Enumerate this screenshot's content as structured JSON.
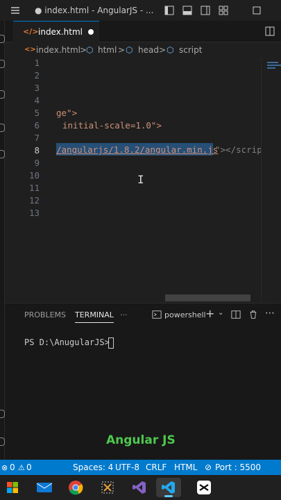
{
  "titlebar": {
    "title": "● index.html - AngularJS - ..."
  },
  "tab": {
    "label": "index.html",
    "icon": "code-icon"
  },
  "breadcrumbs": {
    "file": "index.html",
    "b1": "html",
    "b2": "head",
    "b3": "script",
    "sep": ">"
  },
  "editor": {
    "lines": [
      "1",
      "2",
      "3",
      "4",
      "5",
      "6",
      "7",
      "8",
      "9",
      "10",
      "11",
      "12",
      "13"
    ],
    "line5_text": "ge\">",
    "line6_text": "initial-scale=1.0\">",
    "line8_selected": "/angularjs/1.8.2/angular.min.js",
    "line8_rest": "\"></script"
  },
  "panel": {
    "tabs": [
      "PROBLEMS",
      "TERMINAL"
    ],
    "more": "···",
    "shell": "powershell",
    "prompt": "PS D:\\AnugularJS>"
  },
  "caption": "Angular JS",
  "statusbar": {
    "errors": "0",
    "warnings": "0",
    "spaces": "Spaces: 4",
    "encoding": "UTF-8",
    "eol": "CRLF",
    "language": "HTML",
    "port": "Port : 5500"
  },
  "colors": {
    "accent": "#007acc",
    "selection": "#264f78",
    "caption": "#4ec94e"
  }
}
